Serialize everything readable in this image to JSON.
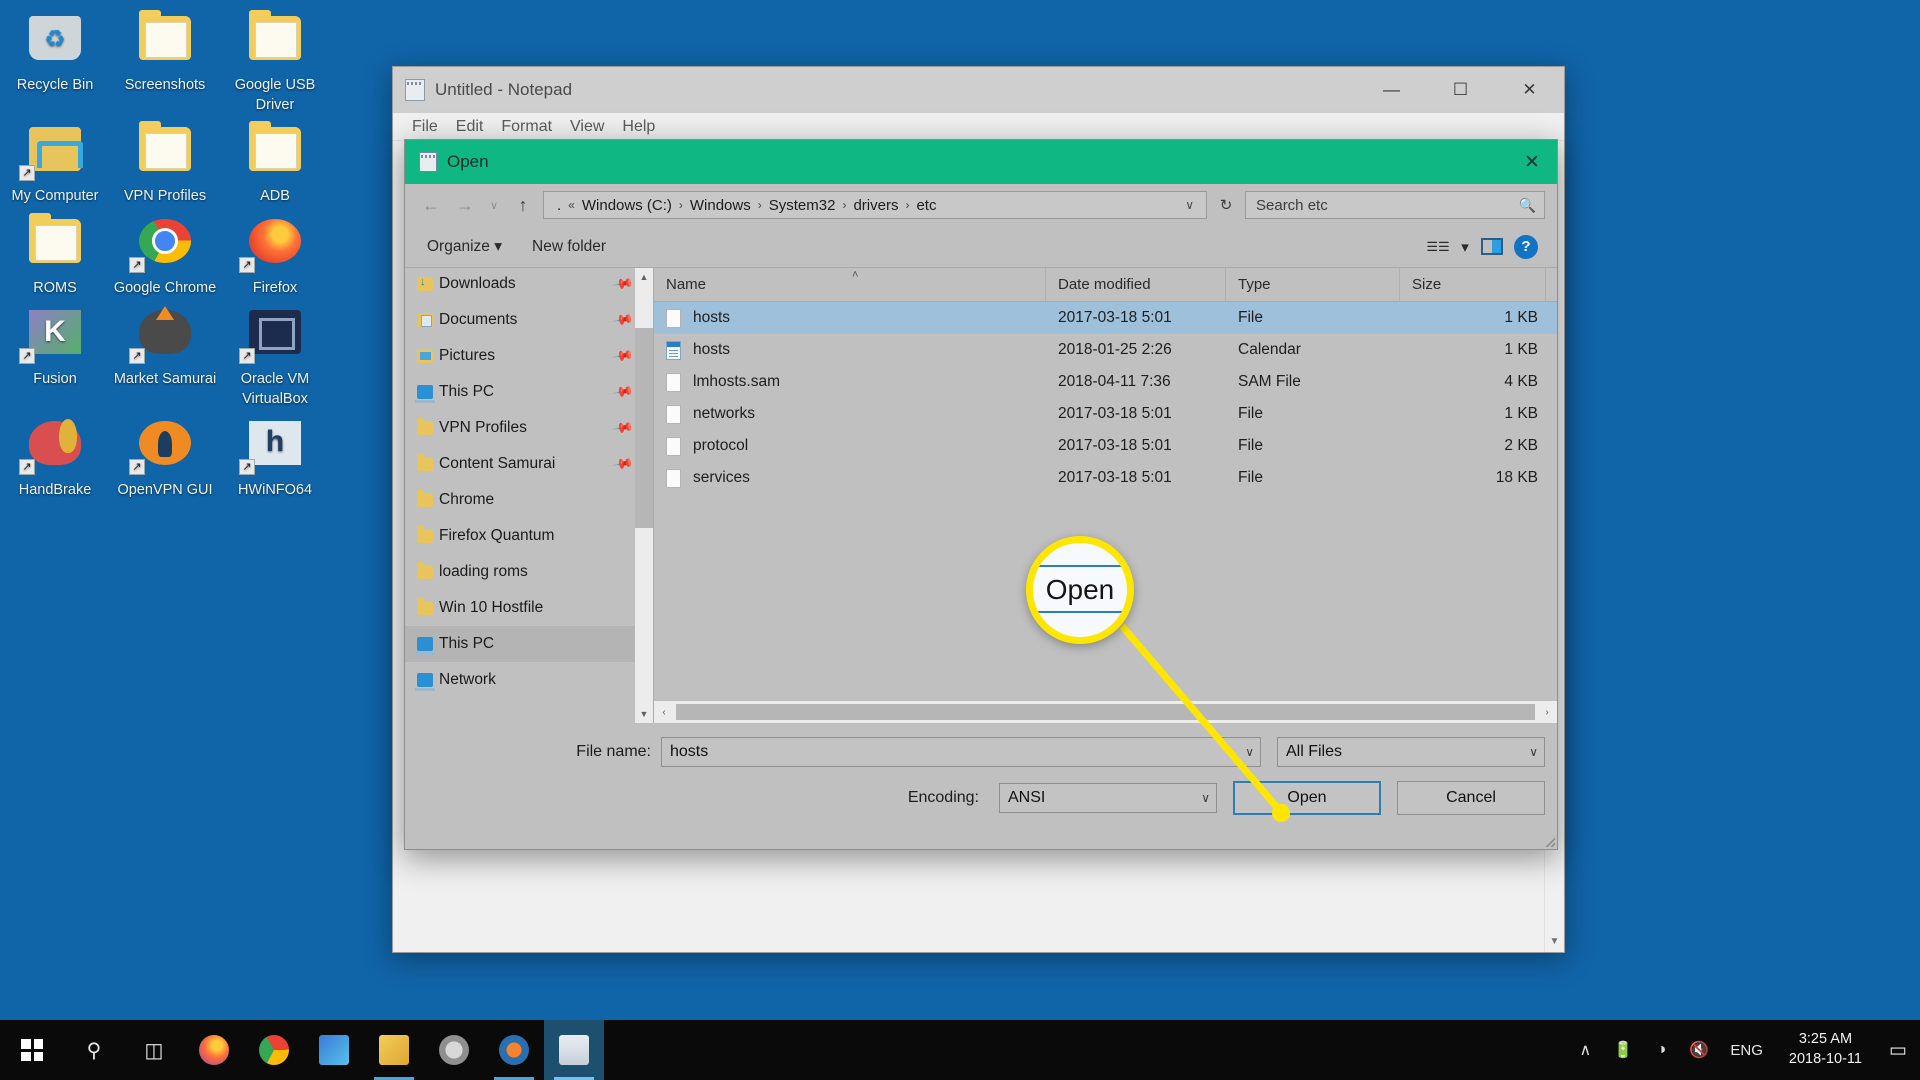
{
  "desktop": {
    "background_color": "#1064a8",
    "icons": [
      {
        "label": "Recycle Bin",
        "icon": "recycle-bin-icon",
        "shape": "ico-bin",
        "shortcut": false
      },
      {
        "label": "Screenshots",
        "icon": "folder-icon",
        "shape": "folder-ico",
        "shortcut": false
      },
      {
        "label": "Google USB Driver",
        "icon": "folder-icon",
        "shape": "folder-ico",
        "shortcut": false
      },
      {
        "label": "My Computer",
        "icon": "my-computer-icon",
        "shape": "ico-mypc",
        "shortcut": true
      },
      {
        "label": "VPN Profiles",
        "icon": "folder-icon",
        "shape": "folder-ico",
        "shortcut": false
      },
      {
        "label": "ADB",
        "icon": "folder-icon",
        "shape": "folder-ico",
        "shortcut": false
      },
      {
        "label": "ROMS",
        "icon": "folder-icon",
        "shape": "folder-ico",
        "shortcut": false
      },
      {
        "label": "Google Chrome",
        "icon": "chrome-icon",
        "shape": "ico-chrome",
        "shortcut": true
      },
      {
        "label": "Firefox",
        "icon": "firefox-icon",
        "shape": "ico-firefox",
        "shortcut": true
      },
      {
        "label": "Fusion",
        "icon": "fusion-icon",
        "shape": "ico-fusion",
        "shortcut": true
      },
      {
        "label": "Market Samurai",
        "icon": "market-samurai-icon",
        "shape": "ico-samurai",
        "shortcut": true
      },
      {
        "label": "Oracle VM VirtualBox",
        "icon": "virtualbox-icon",
        "shape": "ico-vbox",
        "shortcut": true
      },
      {
        "label": "HandBrake",
        "icon": "handbrake-icon",
        "shape": "ico-handbrake",
        "shortcut": true
      },
      {
        "label": "OpenVPN GUI",
        "icon": "openvpn-icon",
        "shape": "ico-openvpn",
        "shortcut": true
      },
      {
        "label": "HWiNFO64",
        "icon": "hwinfo-icon",
        "shape": "ico-hwinfo",
        "shortcut": true
      }
    ]
  },
  "notepad": {
    "title": "Untitled - Notepad",
    "app_icon": "notepad-icon",
    "menus": [
      "File",
      "Edit",
      "Format",
      "View",
      "Help"
    ],
    "window_buttons": {
      "minimize": "—",
      "maximize": "☐",
      "close": "✕"
    },
    "scroll_up": "▲",
    "scroll_down": "▼"
  },
  "dialog": {
    "title": "Open",
    "title_icon": "notepad-icon",
    "titlebar_color": "#0fb783",
    "close_label": "✕",
    "nav": {
      "back": "←",
      "forward": "→",
      "recent": "∨",
      "up": "↑"
    },
    "address": {
      "prefix": ".",
      "overflow": "«",
      "crumbs": [
        "Windows (C:)",
        "Windows",
        "System32",
        "drivers",
        "etc"
      ],
      "separator": "›",
      "caret": "∨",
      "refresh": "↻"
    },
    "search": {
      "text": "Search etc",
      "icon": "search-icon"
    },
    "toolbar": {
      "organize": "Organize",
      "organize_caret": "▾",
      "new_folder": "New folder",
      "view_icon": "view-mode-icon",
      "view_caret": "▾",
      "preview_pane_icon": "preview-pane-icon",
      "help_icon": "help-icon",
      "help_glyph": "?"
    },
    "navpane": {
      "items": [
        {
          "label": "Downloads",
          "icon": "downloads-folder-icon",
          "shape": "ni-download",
          "pinned": true,
          "selected": false
        },
        {
          "label": "Documents",
          "icon": "documents-folder-icon",
          "shape": "ni-docs",
          "pinned": true,
          "selected": false
        },
        {
          "label": "Pictures",
          "icon": "pictures-folder-icon",
          "shape": "ni-pics",
          "pinned": true,
          "selected": false
        },
        {
          "label": "This PC",
          "icon": "this-pc-icon",
          "shape": "ni-pc",
          "pinned": true,
          "selected": false
        },
        {
          "label": "VPN Profiles",
          "icon": "folder-icon",
          "shape": "ni-folder",
          "pinned": true,
          "selected": false
        },
        {
          "label": "Content Samurai",
          "icon": "folder-icon",
          "shape": "ni-folder",
          "pinned": true,
          "selected": false
        },
        {
          "label": "Chrome",
          "icon": "folder-icon",
          "shape": "ni-folder",
          "pinned": false,
          "selected": false
        },
        {
          "label": "Firefox Quantum",
          "icon": "folder-icon",
          "shape": "ni-folder",
          "pinned": false,
          "selected": false
        },
        {
          "label": "loading roms",
          "icon": "folder-icon",
          "shape": "ni-folder",
          "pinned": false,
          "selected": false
        },
        {
          "label": "Win 10 Hostfile",
          "icon": "folder-icon",
          "shape": "ni-folder",
          "pinned": false,
          "selected": false
        },
        {
          "label": "This PC",
          "icon": "this-pc-icon",
          "shape": "ni-pc",
          "pinned": false,
          "selected": true
        },
        {
          "label": "Network",
          "icon": "network-icon",
          "shape": "ni-pc",
          "pinned": false,
          "selected": false
        }
      ],
      "scroll_up": "▲",
      "scroll_down": "▼",
      "pin_glyph": "✓"
    },
    "filelist": {
      "columns": [
        "Name",
        "Date modified",
        "Type",
        "Size"
      ],
      "sort_indicator": "˄",
      "rows": [
        {
          "name": "hosts",
          "date": "2017-03-18 5:01",
          "type": "File",
          "size": "1 KB",
          "icon": "file-icon",
          "selected": true
        },
        {
          "name": "hosts",
          "date": "2018-01-25 2:26",
          "type": "Calendar",
          "size": "1 KB",
          "icon": "calendar-file-icon",
          "selected": false
        },
        {
          "name": "lmhosts.sam",
          "date": "2018-04-11 7:36",
          "type": "SAM File",
          "size": "4 KB",
          "icon": "file-icon",
          "selected": false
        },
        {
          "name": "networks",
          "date": "2017-03-18 5:01",
          "type": "File",
          "size": "1 KB",
          "icon": "file-icon",
          "selected": false
        },
        {
          "name": "protocol",
          "date": "2017-03-18 5:01",
          "type": "File",
          "size": "2 KB",
          "icon": "file-icon",
          "selected": false
        },
        {
          "name": "services",
          "date": "2017-03-18 5:01",
          "type": "File",
          "size": "18 KB",
          "icon": "file-icon",
          "selected": false
        }
      ],
      "hscroll_left": "‹",
      "hscroll_right": "›"
    },
    "form": {
      "filename_label": "File name:",
      "filename_value": "hosts",
      "filetype_value": "All Files",
      "encoding_label": "Encoding:",
      "encoding_value": "ANSI",
      "open_button": "Open",
      "cancel_button": "Cancel",
      "combo_caret": "∨"
    }
  },
  "annotation": {
    "callout_label": "Open",
    "highlight_color": "#ffe600"
  },
  "taskbar": {
    "start_icon": "windows-start-icon",
    "search_icon": "search-icon",
    "taskview_icon": "task-view-icon",
    "apps": [
      {
        "name": "firefox-taskbar-icon",
        "running": false,
        "active": false
      },
      {
        "name": "chrome-taskbar-icon",
        "running": false,
        "active": false
      },
      {
        "name": "translator-taskbar-icon",
        "running": false,
        "active": false
      },
      {
        "name": "file-explorer-taskbar-icon",
        "running": true,
        "active": false
      },
      {
        "name": "settings-taskbar-icon",
        "running": false,
        "active": false
      },
      {
        "name": "media-player-taskbar-icon",
        "running": true,
        "active": false
      },
      {
        "name": "notepad-taskbar-icon",
        "running": true,
        "active": true
      }
    ],
    "tray": {
      "chevron": "∧",
      "battery_icon": "battery-icon",
      "wifi_icon": "wifi-icon",
      "volume_icon": "volume-muted-icon",
      "language": "ENG",
      "time": "3:25 AM",
      "date": "2018-10-11",
      "action_center_icon": "action-center-icon",
      "action_center_glyph": "▭"
    }
  }
}
